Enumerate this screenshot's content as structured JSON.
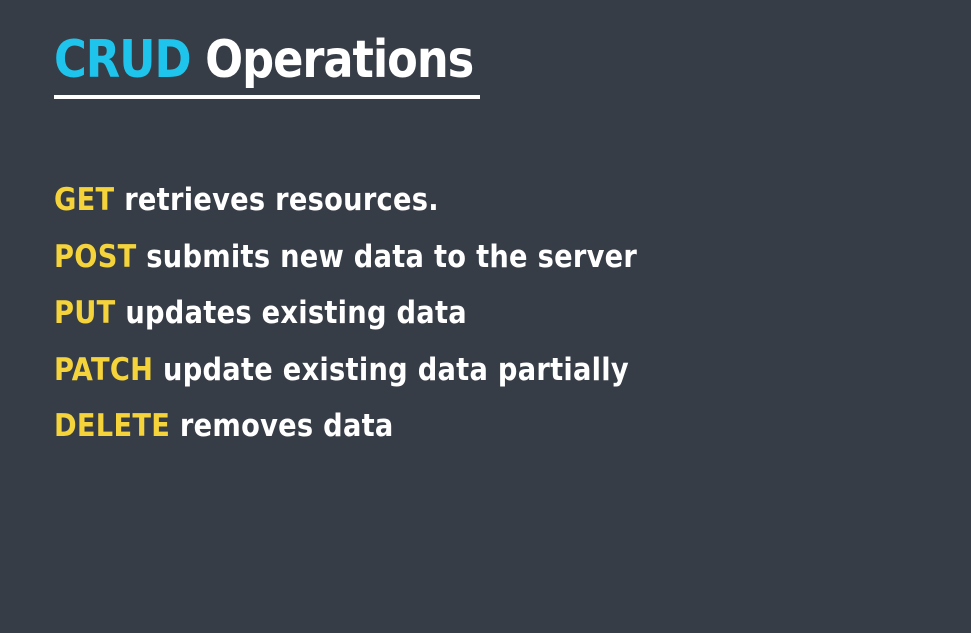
{
  "colors": {
    "background": "#373d47",
    "title_accent": "#1fc4ec",
    "title_text": "#ffffff",
    "method": "#f5d33b",
    "description": "#ffffff"
  },
  "title": {
    "accent": "CRUD",
    "rest": "Operations"
  },
  "operations": [
    {
      "method": "GET",
      "description": "retrieves resources."
    },
    {
      "method": "POST",
      "description": "submits new data to the server"
    },
    {
      "method": "PUT",
      "description": "updates existing data"
    },
    {
      "method": "PATCH",
      "description": "update existing data partially"
    },
    {
      "method": "DELETE",
      "description": "removes data"
    }
  ]
}
